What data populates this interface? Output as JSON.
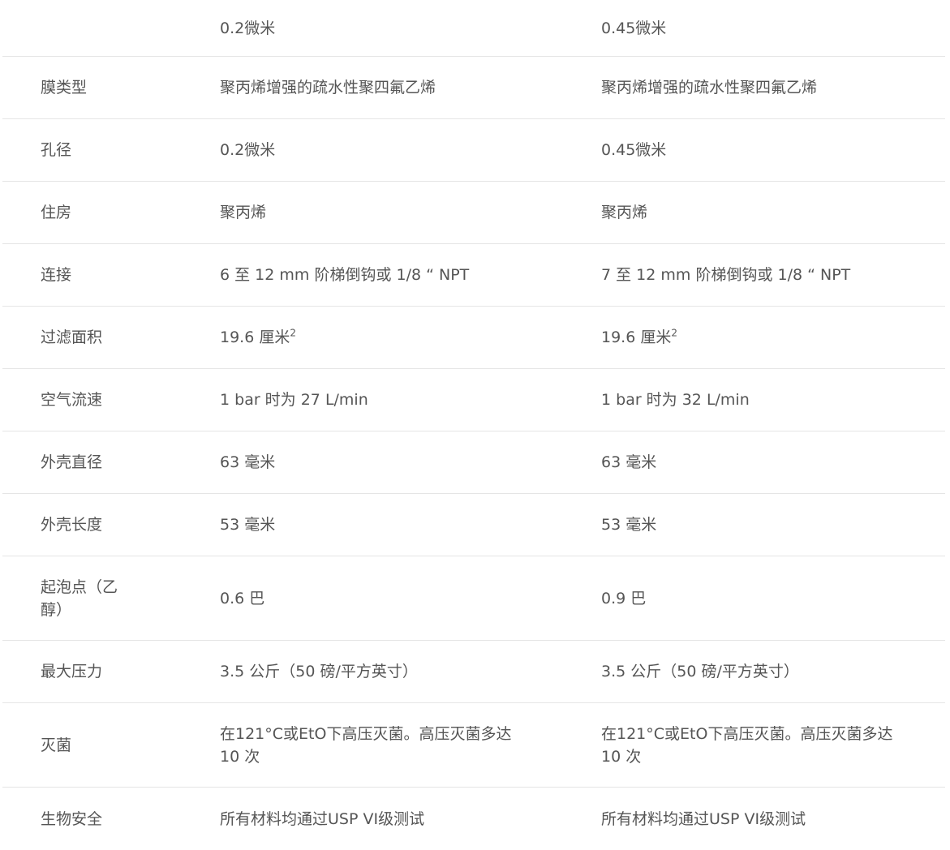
{
  "table": {
    "header": {
      "label": "",
      "col1": "0.2微米",
      "col2": "0.45微米"
    },
    "rows": [
      {
        "label": "膜类型",
        "col1": "聚丙烯增强的疏水性聚四氟乙烯",
        "col2": "聚丙烯增强的疏水性聚四氟乙烯"
      },
      {
        "label": "孔径",
        "col1": "0.2微米",
        "col2": "0.45微米"
      },
      {
        "label": "住房",
        "col1": "聚丙烯",
        "col2": "聚丙烯"
      },
      {
        "label": "连接",
        "col1": "6 至 12 mm 阶梯倒钩或 1/8 “ NPT",
        "col2": "7 至 12 mm 阶梯倒钩或 1/8 “ NPT"
      },
      {
        "label": "过滤面积",
        "col1": "19.6 厘米",
        "col1_sup": "2",
        "col2": "19.6 厘米",
        "col2_sup": "2"
      },
      {
        "label": "空气流速",
        "col1": "1 bar 时为 27 L/min",
        "col2": "1 bar 时为 32 L/min"
      },
      {
        "label": "外壳直径",
        "col1": "63 毫米",
        "col2": "63 毫米"
      },
      {
        "label": "外壳长度",
        "col1": "53 毫米",
        "col2": "53 毫米"
      },
      {
        "label": "起泡点（乙醇）",
        "col1": "0.6 巴",
        "col2": "0.9 巴"
      },
      {
        "label": "最大压力",
        "col1": "3.5 公斤（50 磅/平方英寸）",
        "col2": "3.5 公斤（50 磅/平方英寸）"
      },
      {
        "label": "灭菌",
        "col1": "在121°C或EtO下高压灭菌。高压灭菌多达 10 次",
        "col2": "在121°C或EtO下高压灭菌。高压灭菌多达 10 次"
      },
      {
        "label": "生物安全",
        "col1": "所有材料均通过USP VI级测试",
        "col2": "所有材料均通过USP VI级测试"
      }
    ]
  }
}
